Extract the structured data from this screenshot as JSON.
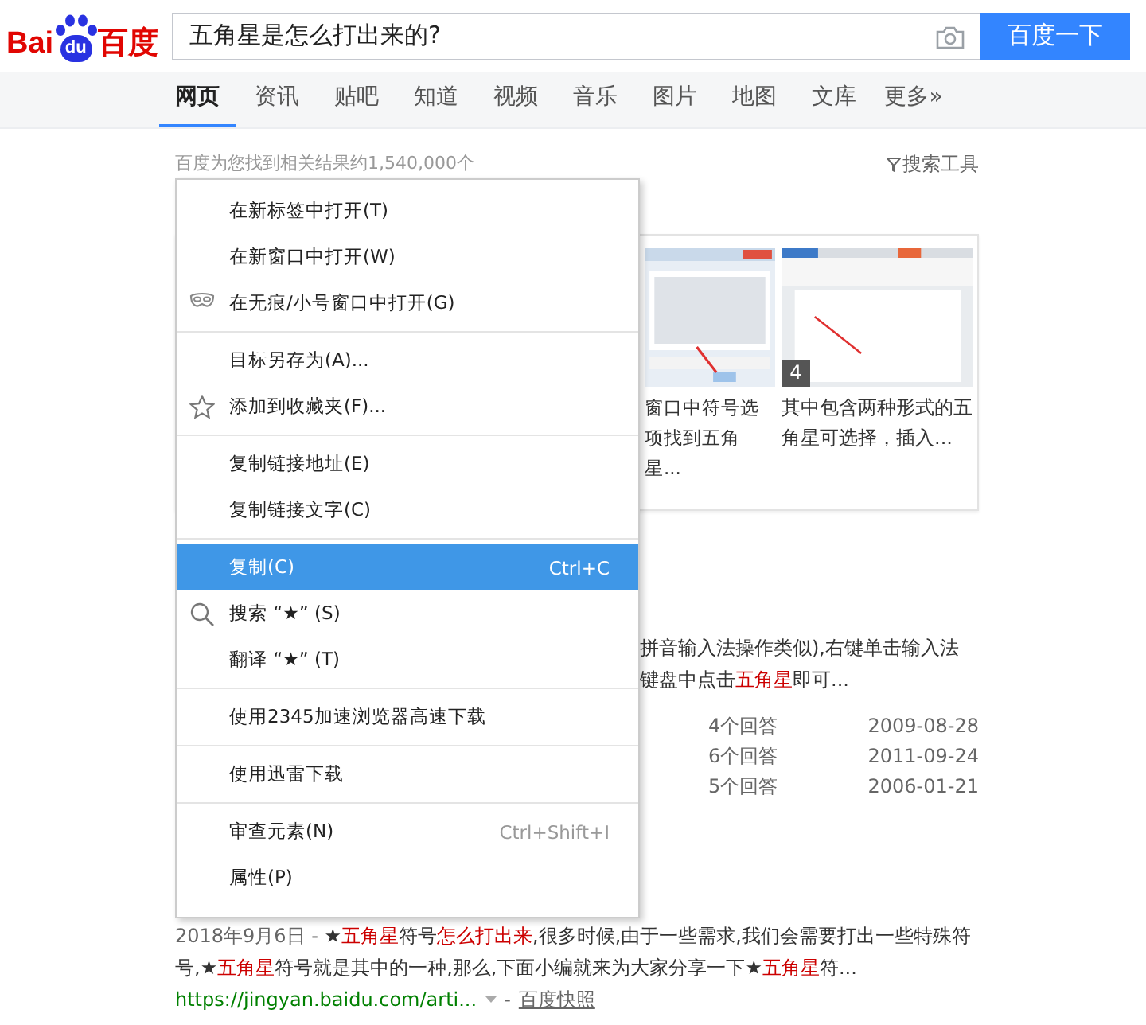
{
  "logo": {
    "left": "Bai",
    "mark": "du",
    "right": "百度"
  },
  "search": {
    "value": "五角星是怎么打出来的?",
    "button": "百度一下"
  },
  "tabs": [
    {
      "label": "网页",
      "selected": true
    },
    {
      "label": "资讯",
      "selected": false
    },
    {
      "label": "贴吧",
      "selected": false
    },
    {
      "label": "知道",
      "selected": false
    },
    {
      "label": "视频",
      "selected": false
    },
    {
      "label": "音乐",
      "selected": false
    },
    {
      "label": "图片",
      "selected": false
    },
    {
      "label": "地图",
      "selected": false
    },
    {
      "label": "文库",
      "selected": false
    },
    {
      "label": "更多»",
      "selected": false
    }
  ],
  "result_count": "百度为您找到相关结果约1,540,000个",
  "search_tools": "搜索工具",
  "image_steps": [
    {
      "kind": "dialog",
      "caption": "窗口中符号选项找到五角星..."
    },
    {
      "kind": "document",
      "badge": "4",
      "caption": "其中包含两种形式的五角星可选择，插入..."
    }
  ],
  "snippet": [
    "拼音输入法操作类似),右键单击输入法",
    "键盘中点击**五角星**即可..."
  ],
  "answers": [
    {
      "count": "4个回答",
      "date": "2009-08-28"
    },
    {
      "count": "6个回答",
      "date": "2011-09-24"
    },
    {
      "count": "5个回答",
      "date": "2006-01-21"
    }
  ],
  "result": {
    "date": "2018年9月6日 -",
    "text": " ★**五角星**符号**怎么打出来**,很多时候,由于一些需求,我们会需要打出一些特殊符号,★**五角星**符号就是其中的一种,那么,下面小编就来为大家分享一下★**五角星**符...",
    "url": "https://jingyan.baidu.com/arti...",
    "dash": "-",
    "cache": "百度快照"
  },
  "context_menu": [
    [
      {
        "kind": "plain",
        "label": "在新标签中打开(T)",
        "selected": false
      },
      {
        "kind": "plain",
        "label": "在新窗口中打开(W)",
        "selected": false
      },
      {
        "kind": "private",
        "label": "在无痕/小号窗口中打开(G)",
        "selected": false
      }
    ],
    [
      {
        "kind": "plain",
        "label": "目标另存为(A)...",
        "selected": false
      },
      {
        "kind": "favorite",
        "label": "添加到收藏夹(F)...",
        "selected": false
      }
    ],
    [
      {
        "kind": "plain",
        "label": "复制链接地址(E)",
        "selected": false
      },
      {
        "kind": "plain",
        "label": "复制链接文字(C)",
        "selected": false
      }
    ],
    [
      {
        "kind": "plain",
        "label": "复制(C)",
        "shortcut": "Ctrl+C",
        "selected": true
      },
      {
        "kind": "search",
        "label": "搜索 “★” (S)",
        "selected": false
      },
      {
        "kind": "plain",
        "label": "翻译 “★” (T)",
        "selected": false
      }
    ],
    [
      {
        "kind": "plain",
        "label": "使用2345加速浏览器高速下载",
        "selected": false
      }
    ],
    [
      {
        "kind": "plain",
        "label": "使用迅雷下载",
        "selected": false
      }
    ],
    [
      {
        "kind": "plain",
        "label": "审查元素(N)",
        "shortcut": "Ctrl+Shift+I",
        "selected": false
      },
      {
        "kind": "plain",
        "label": "属性(P)",
        "selected": false
      }
    ]
  ]
}
